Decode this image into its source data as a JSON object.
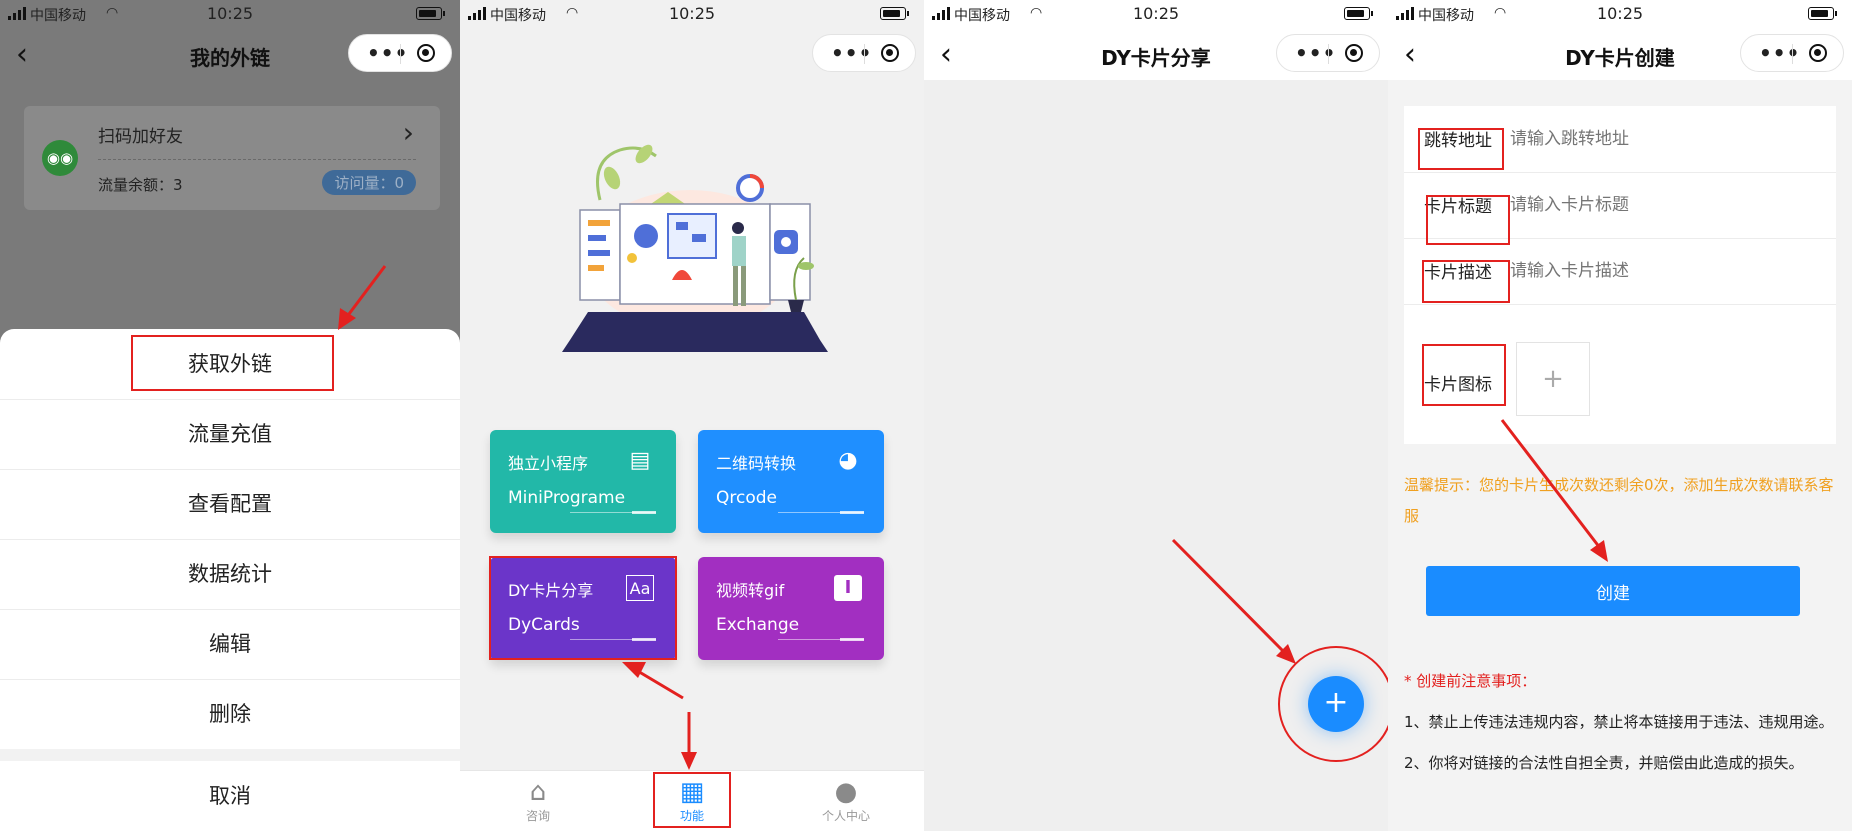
{
  "status_bar": {
    "carrier": "中国移动",
    "time": "10:25"
  },
  "panel1": {
    "title": "我的外链",
    "card": {
      "title": "扫码加好友",
      "traffic": "流量余额：3",
      "visits": "访问量：0"
    },
    "sheet": {
      "items": [
        "获取外链",
        "流量充值",
        "查看配置",
        "数据统计",
        "编辑",
        "删除"
      ],
      "cancel": "取消"
    }
  },
  "panel2": {
    "tiles": [
      {
        "cn": "独立小程序",
        "en": "MiniPrograme",
        "icon": "id-card-icon",
        "color": "#22b8a8"
      },
      {
        "cn": "二维码转换",
        "en": "Qrcode",
        "icon": "palette-icon",
        "color": "#1f8fff"
      },
      {
        "cn": "DY卡片分享",
        "en": "DyCards",
        "icon": "text-style-icon",
        "color": "#6b35c9"
      },
      {
        "cn": "视频转gif",
        "en": "Exchange",
        "icon": "text-cursor-icon",
        "color": "#a22fc1"
      }
    ],
    "tabs": [
      "咨询",
      "功能",
      "个人中心"
    ],
    "active_tab": "功能",
    "active_color": "#1a8cff"
  },
  "panel3": {
    "title": "DY卡片分享",
    "fab": "+"
  },
  "panel4": {
    "title": "DY卡片创建",
    "fields": [
      {
        "label": "跳转地址",
        "placeholder": "请输入跳转地址"
      },
      {
        "label": "卡片标题",
        "placeholder": "请输入卡片标题"
      },
      {
        "label": "卡片描述",
        "placeholder": "请输入卡片描述"
      }
    ],
    "icon_label": "卡片图标",
    "upload_symbol": "+",
    "tip": "温馨提示：您的卡片生成次数还剩余0次，添加生成次数请联系客服",
    "button": "创建",
    "notes_title": "* 创建前注意事项：",
    "notes": [
      "1、禁止上传违法违规内容，禁止将本链接用于违法、违规用途。",
      "2、你将对链接的合法性自担全责，并赔偿由此造成的损失。"
    ]
  },
  "colors": {
    "primary": "#1a8cff",
    "annotation": "#e3211f",
    "warning": "#f0a020"
  }
}
